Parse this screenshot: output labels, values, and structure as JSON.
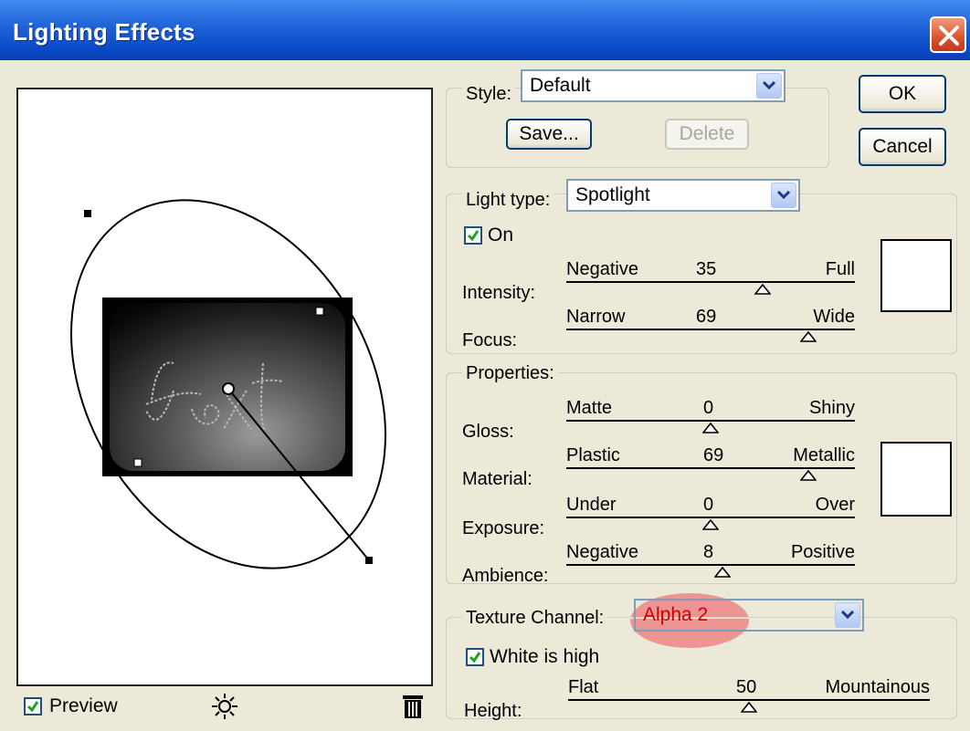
{
  "window": {
    "title": "Lighting Effects"
  },
  "preview": {
    "label": "Preview",
    "checked": true,
    "canvas_text": "text"
  },
  "buttons": {
    "ok": "OK",
    "cancel": "Cancel",
    "save": "Save...",
    "delete": "Delete"
  },
  "style": {
    "label": "Style:",
    "value": "Default"
  },
  "light_type": {
    "label": "Light type:",
    "value": "Spotlight",
    "on_label": "On",
    "on_checked": true
  },
  "light_sliders": [
    {
      "label": "Intensity:",
      "min": "Negative",
      "value": "35",
      "max": "Full",
      "level": 0.68
    },
    {
      "label": "Focus:",
      "min": "Narrow",
      "value": "69",
      "max": "Wide",
      "level": 0.84
    }
  ],
  "properties": {
    "label": "Properties:",
    "sliders": [
      {
        "label": "Gloss:",
        "min": "Matte",
        "value": "0",
        "max": "Shiny",
        "level": 0.5
      },
      {
        "label": "Material:",
        "min": "Plastic",
        "value": "69",
        "max": "Metallic",
        "level": 0.84
      },
      {
        "label": "Exposure:",
        "min": "Under",
        "value": "0",
        "max": "Over",
        "level": 0.5
      },
      {
        "label": "Ambience:",
        "min": "Negative",
        "value": "8",
        "max": "Positive",
        "level": 0.54
      }
    ]
  },
  "texture": {
    "label": "Texture Channel:",
    "value": "Alpha 2",
    "value_color": "#cc0000",
    "white_is_high_label": "White is high",
    "white_is_high_checked": true,
    "height": {
      "label": "Height:",
      "min": "Flat",
      "value": "50",
      "max": "Mountainous",
      "level": 0.5
    }
  },
  "colors": {
    "titlebar": "#0a4bc8",
    "dialog": "#ece9d8",
    "highlight": "#ee7878"
  }
}
